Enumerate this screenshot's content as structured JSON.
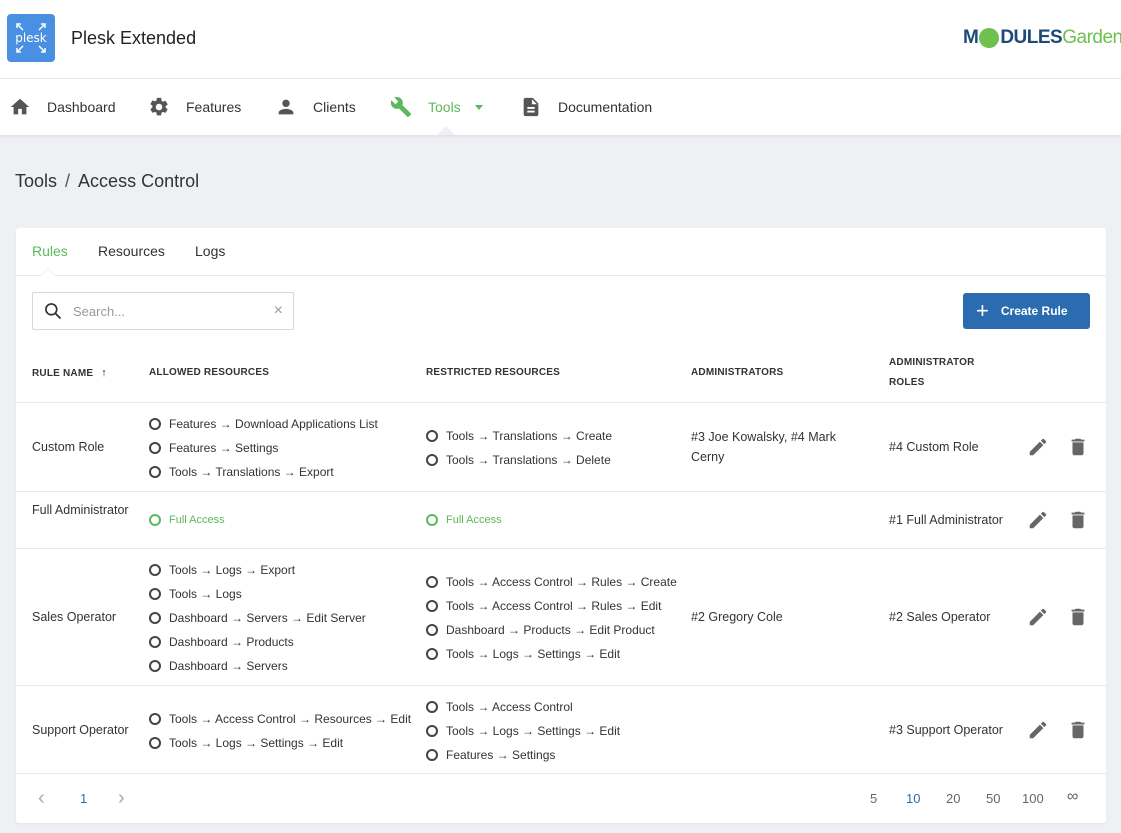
{
  "app": {
    "logo_text": "plesk",
    "title": "Plesk Extended"
  },
  "brand": {
    "part1": "M",
    "part2": "DULES",
    "part3": "Garden"
  },
  "nav": {
    "dashboard": "Dashboard",
    "features": "Features",
    "clients": "Clients",
    "tools": "Tools",
    "documentation": "Documentation"
  },
  "breadcrumb": {
    "parent": "Tools",
    "separator": "/",
    "current": "Access Control"
  },
  "tabs": {
    "rules": "Rules",
    "resources": "Resources",
    "logs": "Logs"
  },
  "search": {
    "placeholder": "Search...",
    "clear": "×"
  },
  "create_button": {
    "plus": "+",
    "label": "Create Rule"
  },
  "table": {
    "headers": {
      "rule_name": "Rule Name",
      "sort": "↑",
      "allowed": "Allowed Resources",
      "restricted": "Restricted Resources",
      "administrators": "Administrators",
      "roles_line1": "Administrator",
      "roles_line2": "Roles"
    },
    "rows": [
      {
        "name": "Custom Role",
        "allowed": [
          "Features → Download Applications List",
          "Features → Settings",
          "Tools → Translations → Export"
        ],
        "restricted": [
          "Tools → Translations → Create",
          "Tools → Translations → Delete"
        ],
        "administrators": "#3 Joe Kowalsky, #4 Mark Cerny",
        "roles": "#4 Custom Role"
      },
      {
        "name": "Full Administrator",
        "allowed": [
          "Full Access"
        ],
        "restricted": [
          "Full Access"
        ],
        "administrators": "",
        "roles": "#1 Full Administrator"
      },
      {
        "name": "Sales Operator",
        "allowed": [
          "Tools → Logs → Export",
          "Tools → Logs",
          "Dashboard → Servers → Edit Server",
          "Dashboard → Products",
          "Dashboard → Servers"
        ],
        "restricted": [
          "Tools → Access Control → Rules → Create",
          "Tools → Access Control → Rules → Edit",
          "Dashboard → Products → Edit Product",
          "Tools → Logs → Settings → Edit"
        ],
        "administrators": "#2 Gregory Cole",
        "roles": "#2 Sales Operator"
      },
      {
        "name": "Support Operator",
        "allowed": [
          "Tools → Access Control → Resources → Edit",
          "Tools → Logs → Settings → Edit"
        ],
        "restricted": [
          "Tools → Access Control",
          "Tools → Logs → Settings → Edit",
          "Features → Settings"
        ],
        "administrators": "",
        "roles": "#3 Support Operator"
      }
    ]
  },
  "pagination": {
    "prev": "‹",
    "current_page": "1",
    "next": "›",
    "sizes": [
      "5",
      "10",
      "20",
      "50",
      "100",
      "∞"
    ],
    "active_size": "10"
  },
  "colors": {
    "accent_green": "#5cb85c",
    "primary_blue": "#2b6cb0",
    "logo_blue": "#4a90e2"
  }
}
